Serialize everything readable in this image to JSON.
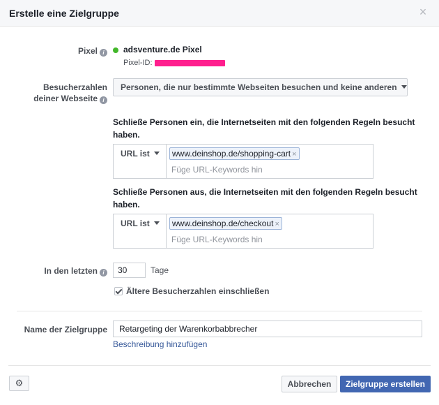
{
  "dialog": {
    "title": "Erstelle eine Zielgruppe",
    "close_icon": "close-icon"
  },
  "pixel": {
    "label": "Pixel",
    "name": "adsventure.de Pixel",
    "id_label": "Pixel-ID:",
    "status_color": "#42b72a"
  },
  "visitors": {
    "label_line1": "Besucherzahlen",
    "label_line2": "deiner Webseite",
    "selected": "Personen, die nur bestimmte Webseiten besuchen und keine anderen"
  },
  "include": {
    "text": "Schließe Personen ein, die Internetseiten mit den folgenden Regeln besucht haben.",
    "rule": "URL ist",
    "token": "www.deinshop.de/shopping-cart",
    "placeholder": "Füge URL-Keywords hin"
  },
  "exclude": {
    "text": "Schließe Personen aus, die Internetseiten mit den folgenden Regeln besucht haben.",
    "rule": "URL ist",
    "token": "www.deinshop.de/checkout",
    "placeholder": "Füge URL-Keywords hin"
  },
  "retention": {
    "label": "In den letzten",
    "days": "30",
    "unit": "Tage",
    "checkbox_label": "Ältere Besucherzahlen einschließen",
    "checked": true
  },
  "audience_name": {
    "label": "Name der Zielgruppe",
    "value": "Retargeting der Warenkorbabbrecher",
    "description_link": "Beschreibung hinzufügen"
  },
  "footer": {
    "cancel": "Abbrechen",
    "create": "Zielgruppe erstellen",
    "accent": "#4267b2"
  },
  "icons": {
    "close": "×",
    "info": "i",
    "gear": "⚙",
    "remove": "×"
  }
}
